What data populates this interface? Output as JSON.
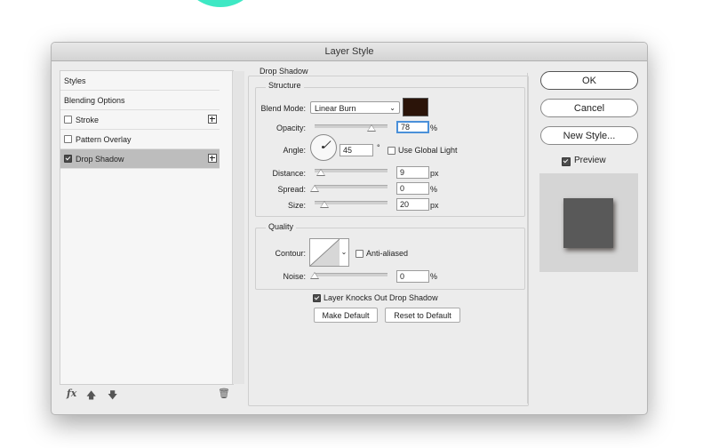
{
  "dialog": {
    "title": "Layer Style"
  },
  "styles_panel": {
    "items": [
      {
        "label": "Styles",
        "checkbox": false,
        "checked": false,
        "plus": false,
        "selected": false
      },
      {
        "label": "Blending Options",
        "checkbox": false,
        "checked": false,
        "plus": false,
        "selected": false
      },
      {
        "label": "Stroke",
        "checkbox": true,
        "checked": false,
        "plus": true,
        "selected": false
      },
      {
        "label": "Pattern Overlay",
        "checkbox": true,
        "checked": false,
        "plus": false,
        "selected": false
      },
      {
        "label": "Drop Shadow",
        "checkbox": true,
        "checked": true,
        "plus": true,
        "selected": true
      }
    ],
    "bottom_icons": [
      "fx-icon",
      "arrow-up-icon",
      "arrow-down-icon",
      "trash-icon"
    ],
    "fx_label": "fx"
  },
  "drop_shadow": {
    "section_title": "Drop Shadow",
    "structure": {
      "title": "Structure",
      "blend_mode_label": "Blend Mode:",
      "blend_mode_value": "Linear Burn",
      "shadow_color": "#2b1409",
      "opacity_label": "Opacity:",
      "opacity_value": "78",
      "opacity_unit": "%",
      "opacity_fraction": 0.78,
      "angle_label": "Angle:",
      "angle_value": "45",
      "angle_unit": "°",
      "use_global_light_label": "Use Global Light",
      "use_global_light_checked": false,
      "distance_label": "Distance:",
      "distance_value": "9",
      "distance_unit": "px",
      "spread_label": "Spread:",
      "spread_value": "0",
      "spread_unit": "%",
      "size_label": "Size:",
      "size_value": "20",
      "size_unit": "px"
    },
    "quality": {
      "title": "Quality",
      "contour_label": "Contour:",
      "anti_aliased_label": "Anti-aliased",
      "anti_aliased_checked": false,
      "noise_label": "Noise:",
      "noise_value": "0",
      "noise_unit": "%"
    },
    "knocks_out_label": "Layer Knocks Out Drop Shadow",
    "knocks_out_checked": true,
    "make_default_label": "Make Default",
    "reset_default_label": "Reset to Default"
  },
  "actions": {
    "ok_label": "OK",
    "cancel_label": "Cancel",
    "new_style_label": "New Style...",
    "preview_label": "Preview",
    "preview_checked": true
  },
  "colors": {
    "accent_focus": "#4a90d9",
    "selected_row": "#bdbdbd",
    "preview_bg": "#d5d5d5",
    "preview_square": "#595959"
  }
}
